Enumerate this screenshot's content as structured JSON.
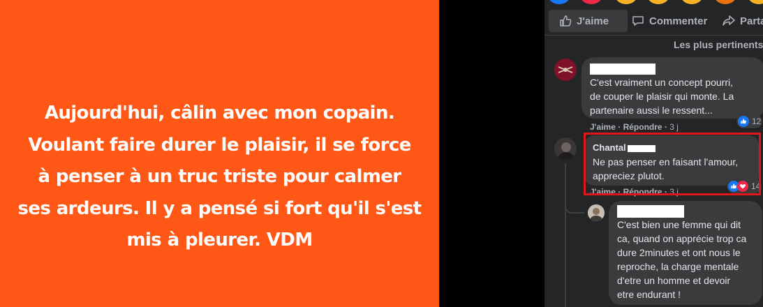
{
  "post": {
    "text_lines": [
      "Aujourd'hui, câlin avec mon copain.",
      "Voulant faire durer le plaisir, il se force",
      "à penser à un truc triste pour calmer",
      "ses ardeurs. Il y a pensé si fort qu'il s'est",
      "mis à pleurer. VDM"
    ],
    "background_color": "#fe5716"
  },
  "actions": {
    "like": "J'aime",
    "comment": "Commenter",
    "share": "Partager"
  },
  "sort_label": "Les plus pertinents",
  "comments": [
    {
      "author": "",
      "text": [
        "C'est vraiment un concept pourri,",
        "de couper le plaisir qui monte. La",
        "partenaire aussi le ressent..."
      ],
      "meta": {
        "like": "J'aime",
        "reply": "Répondre",
        "time": "3 j"
      },
      "reaction_count": "12"
    },
    {
      "author": "Chantal",
      "text": [
        "Ne pas penser en faisant l'amour,",
        "appreciez plutot."
      ],
      "meta": {
        "like": "J'aime",
        "reply": "Répondre",
        "time": "3 j"
      },
      "reaction_count": "14"
    },
    {
      "author": "",
      "text": [
        "C'est bien une femme qui dit",
        "ca, quand on apprécie trop ca",
        "dure 2minutes et ont nous le",
        "reproche, la charge mentale",
        "d'etre un homme et devoir",
        "etre endurant !"
      ]
    }
  ],
  "colors": {
    "panel": "#242526",
    "bubble": "#3a3b3c",
    "highlight": "#e0161b",
    "like_blue": "#1877f2"
  }
}
